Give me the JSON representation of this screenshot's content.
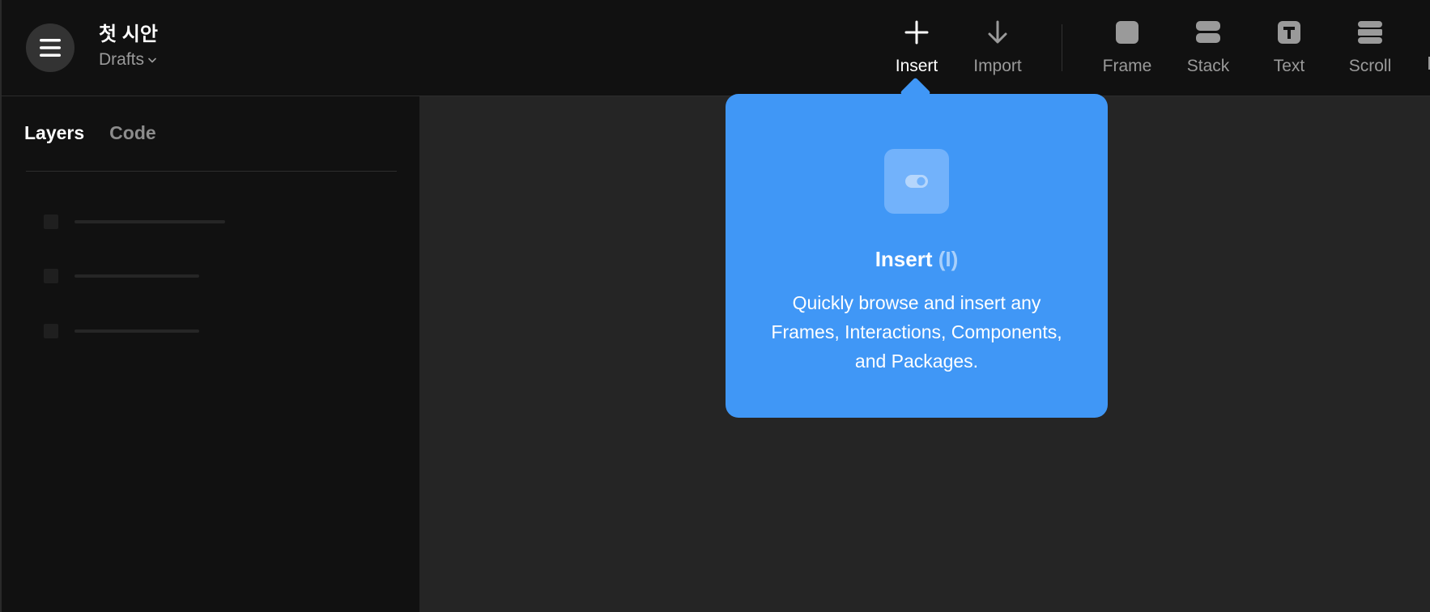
{
  "header": {
    "project_name": "첫 시안",
    "project_folder": "Drafts"
  },
  "toolbar": {
    "tools": [
      {
        "label": "Insert",
        "icon": "plus-icon",
        "active": true
      },
      {
        "label": "Import",
        "icon": "arrow-down-icon",
        "active": false
      },
      {
        "label": "Frame",
        "icon": "frame-icon",
        "active": false
      },
      {
        "label": "Stack",
        "icon": "stack-icon",
        "active": false
      },
      {
        "label": "Text",
        "icon": "text-icon",
        "active": false
      },
      {
        "label": "Scroll",
        "icon": "scroll-icon",
        "active": false
      }
    ]
  },
  "sidebar": {
    "tabs": [
      {
        "label": "Layers",
        "active": true
      },
      {
        "label": "Code",
        "active": false
      }
    ]
  },
  "popover": {
    "title": "Insert",
    "shortcut": "(I)",
    "description": "Quickly browse and insert any Frames, Interactions, Components, and Packages.",
    "icon": "toggle-icon"
  },
  "colors": {
    "accent": "#4097f6",
    "topbar_bg": "#111111",
    "canvas_bg": "#252525"
  }
}
